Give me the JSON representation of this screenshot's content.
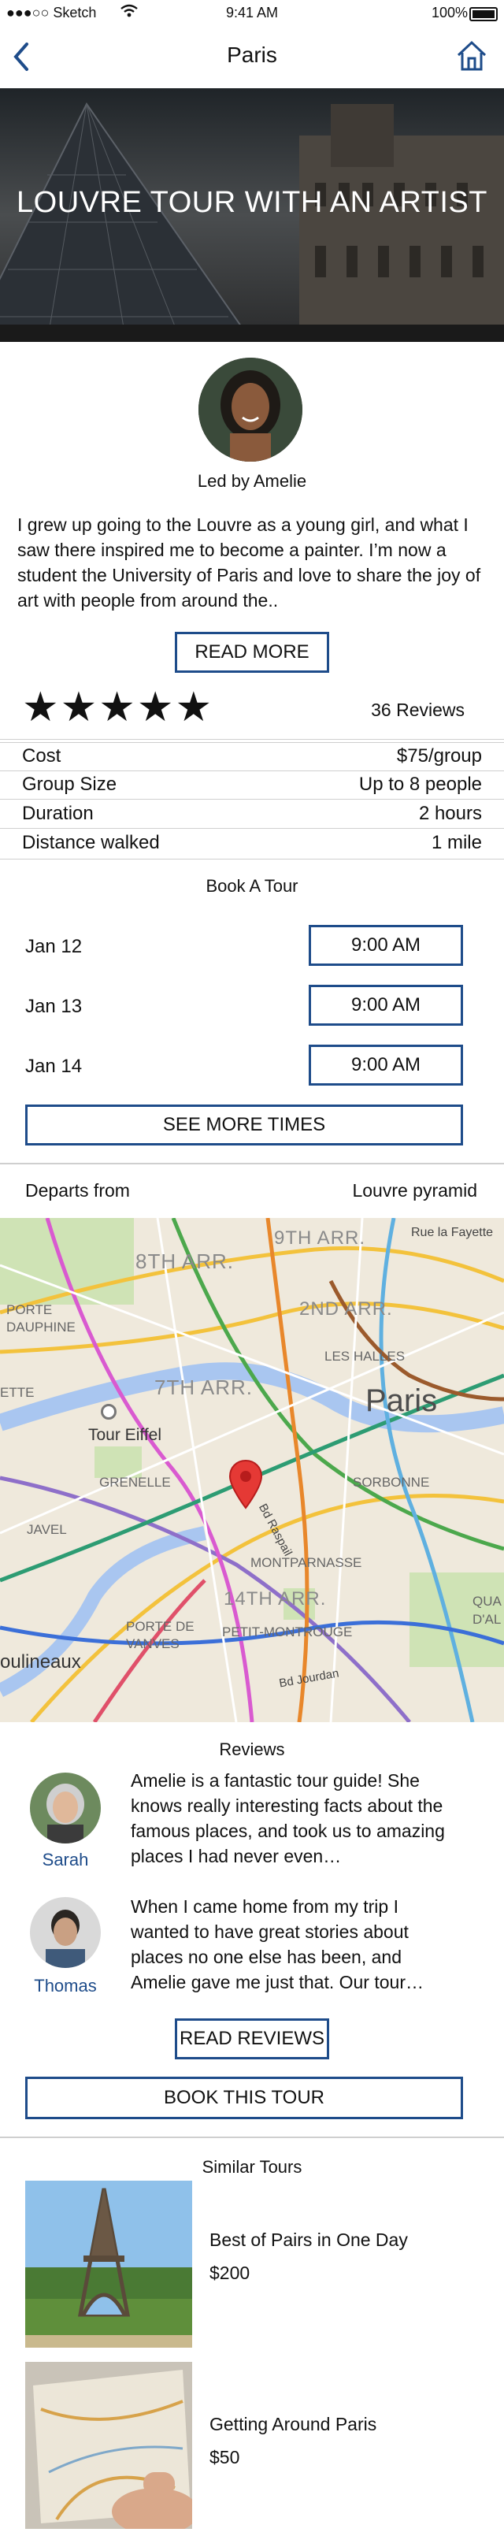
{
  "status_bar": {
    "carrier": "●●●○○ Sketch",
    "wifi_icon": "wifi-icon",
    "time": "9:41 AM",
    "battery": "100%"
  },
  "nav": {
    "title": "Paris",
    "back_icon": "chevron-left-icon",
    "home_icon": "home-icon"
  },
  "hero": {
    "title": "LOUVRE TOUR WITH AN ARTIST"
  },
  "guide": {
    "led_by": "Led by Amelie",
    "bio": "I grew up going to the Louvre as a young girl, and what I saw there inspired me to become a painter. I’m now a student the University of Paris and love to share the joy of art with people from around the..",
    "read_more": "READ MORE"
  },
  "rating": {
    "stars": 5,
    "max": 5,
    "reviews_count": "36 Reviews"
  },
  "details": [
    {
      "label": "Cost",
      "value": "$75/group"
    },
    {
      "label": "Group Size",
      "value": "Up to 8 people"
    },
    {
      "label": "Duration",
      "value": "2 hours"
    },
    {
      "label": "Distance walked",
      "value": "1 mile"
    }
  ],
  "booking": {
    "heading": "Book A Tour",
    "slots": [
      {
        "date": "Jan 12",
        "time": "9:00 AM"
      },
      {
        "date": "Jan 13",
        "time": "9:00 AM"
      },
      {
        "date": "Jan 14",
        "time": "9:00 AM"
      }
    ],
    "see_more": "SEE MORE TIMES"
  },
  "departs": {
    "label": "Departs from",
    "value": "Louvre pyramid"
  },
  "map": {
    "labels": {
      "arr9": "9TH ARR.",
      "arr8": "8TH ARR.",
      "rue": "Rue la Fayette",
      "arr2": "2ND ARR.",
      "porte": "PORTE DAUPHINE",
      "halles": "LES HALLES",
      "arr7": "7TH ARR.",
      "ette": "ETTE",
      "paris": "Paris",
      "eiffel": "Tour Eiffel",
      "grenelle": "GRENELLE",
      "sorbonne": "SORBONNE",
      "raspail": "Bd Raspail",
      "javel": "JAVEL",
      "montparnasse": "MONTPARNASSE",
      "arr14": "14TH ARR.",
      "qua": "QUA",
      "dal": "D'AL",
      "vanves": "PORTE DE VANVES",
      "petit": "PETIT-MONTROUGE",
      "moulineaux": "oulineaux",
      "jourdan": "Bd Jourdan"
    }
  },
  "reviews": {
    "heading": "Reviews",
    "items": [
      {
        "name": "Sarah",
        "text": "Amelie is a fantastic tour guide! She knows really interesting facts about the famous places, and took us to amazing places I had never even…"
      },
      {
        "name": "Thomas",
        "text": "When I came home from my trip I wanted to have great stories about places no one else has been, and Amelie gave me just that. Our tour…"
      }
    ],
    "read_reviews": "READ REVIEWS"
  },
  "book_button": "BOOK THIS TOUR",
  "similar": {
    "heading": "Similar Tours",
    "items": [
      {
        "title": "Best of Pairs in One Day",
        "price": "$200"
      },
      {
        "title": "Getting Around Paris",
        "price": "$50"
      }
    ]
  },
  "colors": {
    "accent": "#1e4c8a",
    "star": "#111111",
    "map_pin": "#e53935"
  }
}
